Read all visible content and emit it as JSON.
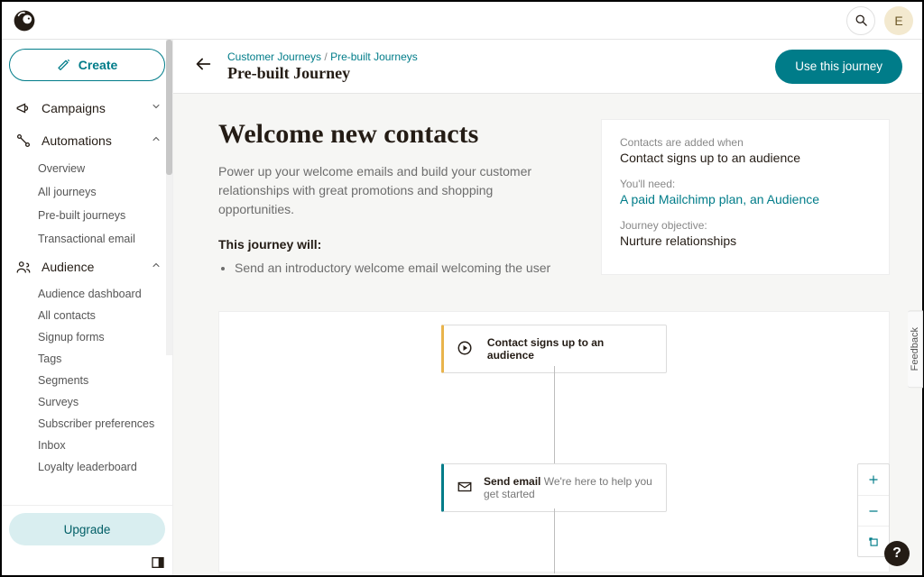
{
  "header": {
    "avatar_initial": "E"
  },
  "sidebar": {
    "create_label": "Create",
    "sections": {
      "campaigns": "Campaigns",
      "automations": "Automations",
      "audience": "Audience"
    },
    "automations_items": [
      "Overview",
      "All journeys",
      "Pre-built journeys",
      "Transactional email"
    ],
    "audience_items": [
      "Audience dashboard",
      "All contacts",
      "Signup forms",
      "Tags",
      "Segments",
      "Surveys",
      "Subscriber preferences",
      "Inbox",
      "Loyalty leaderboard"
    ],
    "upgrade_label": "Upgrade"
  },
  "page": {
    "breadcrumb_root": "Customer Journeys",
    "breadcrumb_leaf": "Pre-built Journeys",
    "title": "Pre-built Journey",
    "cta_label": "Use this journey"
  },
  "hero": {
    "title": "Welcome new contacts",
    "description": "Power up your welcome emails and build your customer relationships with great promotions and shopping opportunities.",
    "will_title": "This journey will:",
    "will_items": [
      "Send an introductory welcome email welcoming the user"
    ]
  },
  "meta": {
    "contacts_label": "Contacts are added when",
    "contacts_value": "Contact signs up to an audience",
    "need_label": "You'll need:",
    "need_link1": "A paid Mailchimp plan",
    "need_sep": ", ",
    "need_link2": "an Audience",
    "objective_label": "Journey objective:",
    "objective_value": "Nurture relationships"
  },
  "canvas": {
    "node1_label": "Contact signs up to an audience",
    "node2_title": "Send email",
    "node2_sub": "We're here to help you get started"
  },
  "feedback_label": "Feedback"
}
